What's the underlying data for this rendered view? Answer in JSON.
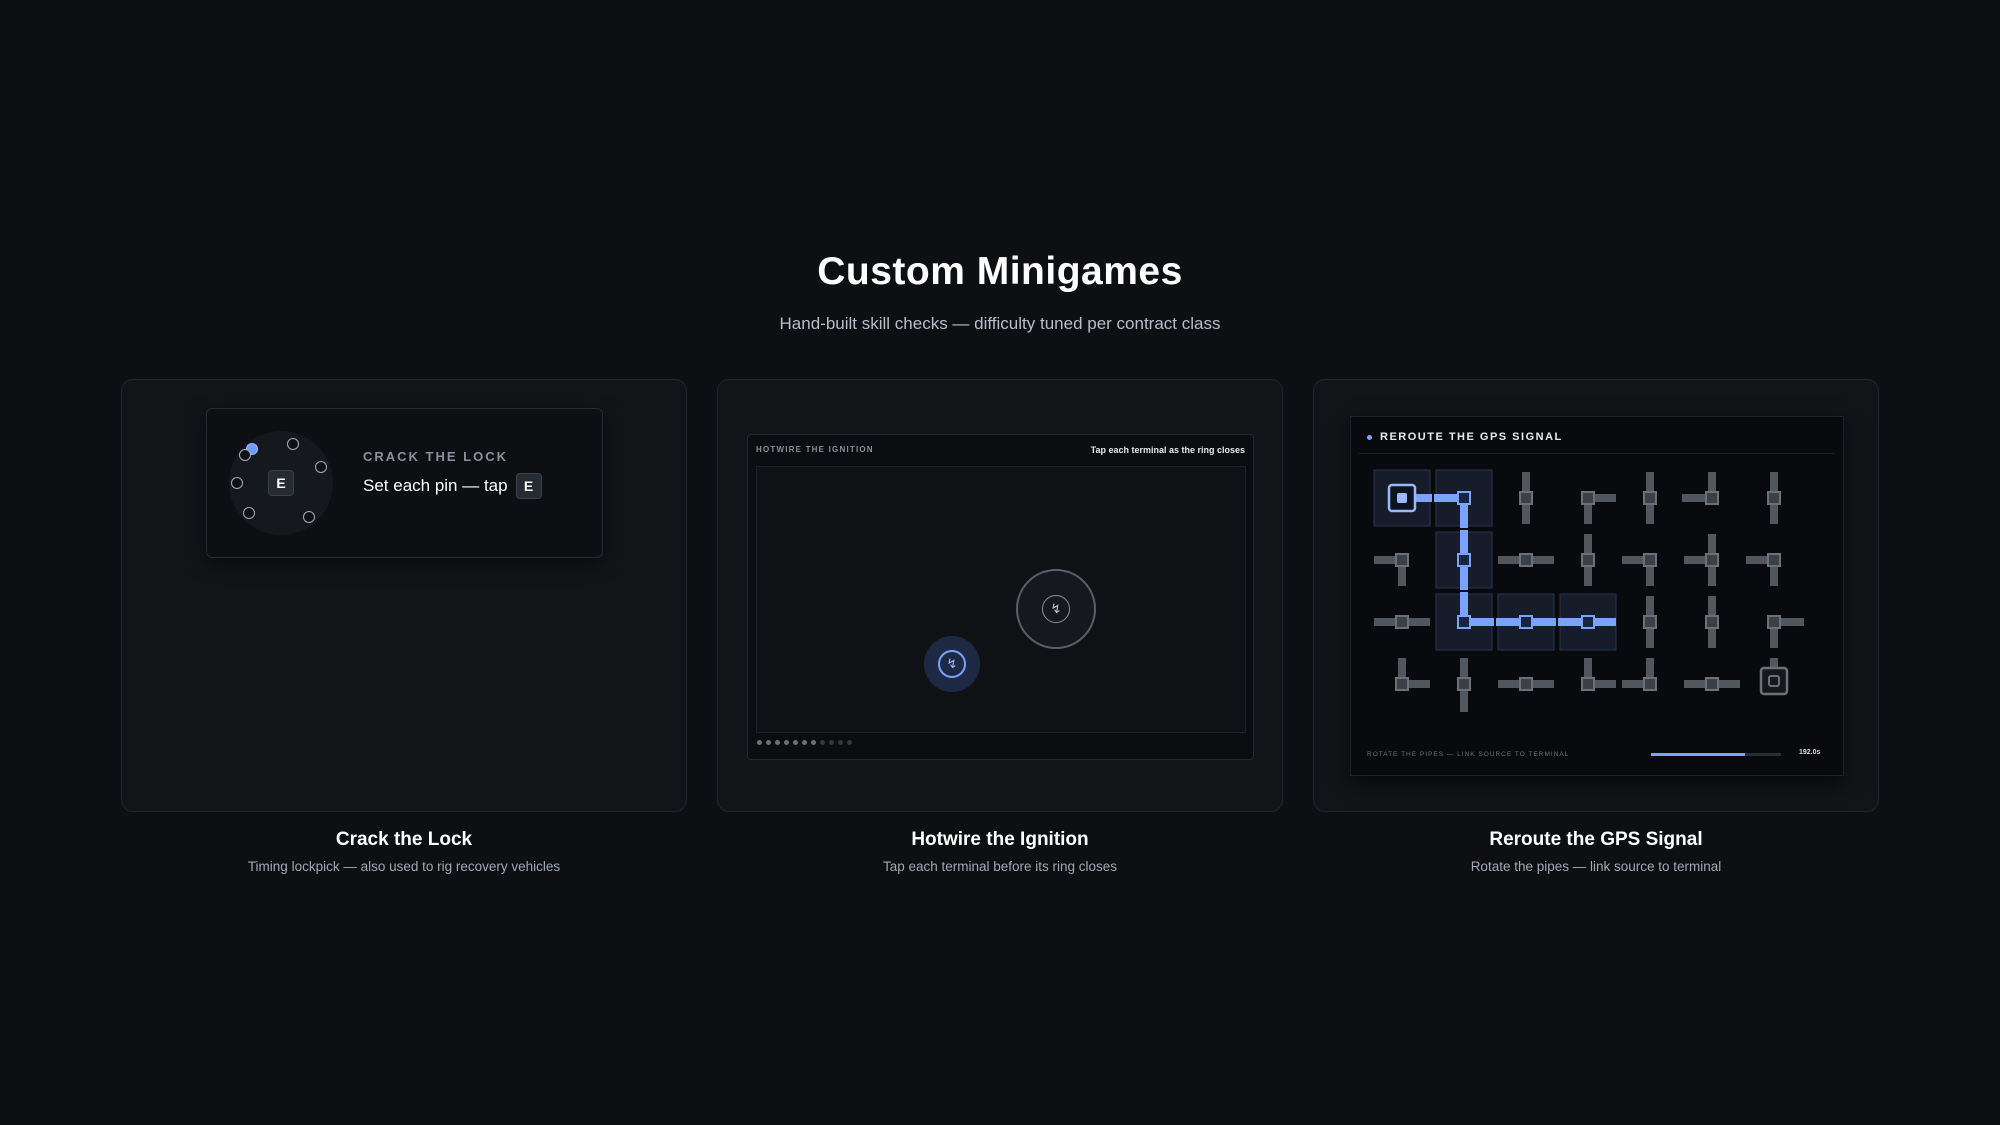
{
  "section": {
    "title": "Custom Minigames",
    "subtitle": "Hand-built skill checks — difficulty tuned per contract class"
  },
  "cards": [
    {
      "title": "Crack the Lock",
      "description": "Timing lockpick — also used to rig recovery vehicles",
      "preview": {
        "label": "CRACK THE LOCK",
        "instruction": "Set each pin — tap",
        "key": "E",
        "pins_total": 7,
        "pins_set": 1
      }
    },
    {
      "title": "Hotwire the Ignition",
      "description": "Tap each terminal before its ring closes",
      "preview": {
        "label": "HOTWIRE THE IGNITION",
        "hint": "Tap each terminal as the ring closes",
        "progress_dots_total": 11,
        "progress_dots_done": 7
      }
    },
    {
      "title": "Reroute the GPS Signal",
      "description": "Rotate the pipes — link source to terminal",
      "preview": {
        "label": "REROUTE THE GPS SIGNAL",
        "footer": "ROTATE THE PIPES — LINK SOURCE TO TERMINAL",
        "timer": "192.0s",
        "progress": 0.72
      }
    }
  ],
  "colors": {
    "background": "#0d0f12",
    "card": "#121418",
    "accent": "#7aa2ff",
    "pipe": "#52565d"
  },
  "icons": [
    "lock-dial-icon",
    "keycap-icon",
    "terminal-icon",
    "pipe-source-icon",
    "pipe-terminal-icon"
  ]
}
